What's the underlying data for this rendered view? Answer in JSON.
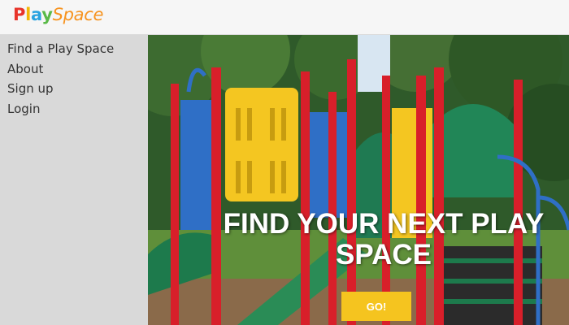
{
  "app": {
    "logo_play": "Play",
    "logo_space": "Space"
  },
  "sidebar": {
    "items": [
      {
        "label": "Find a Play Space"
      },
      {
        "label": "About"
      },
      {
        "label": "Sign up"
      },
      {
        "label": "Login"
      }
    ]
  },
  "hero": {
    "heading": "FIND YOUR NEXT PLAY SPACE",
    "button_label": "GO!"
  },
  "colors": {
    "sidebar_bg": "#d9d9d9",
    "button": "#f5c41f",
    "logo_red": "#e8342a",
    "logo_orange": "#f7931e"
  }
}
